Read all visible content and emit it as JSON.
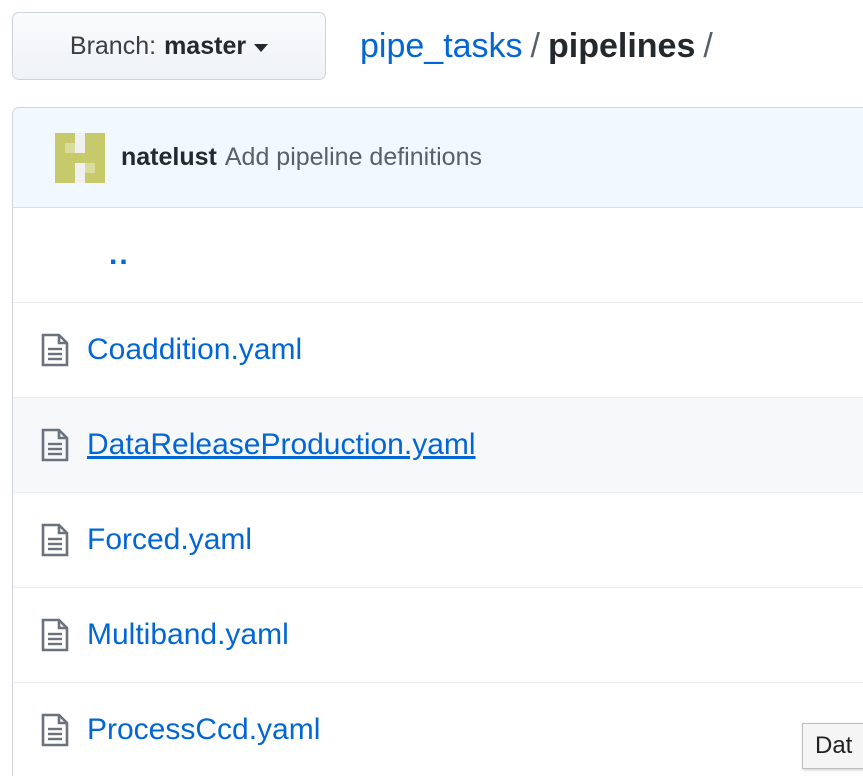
{
  "branch_selector": {
    "prefix": "Branch:",
    "branch": "master"
  },
  "breadcrumb": {
    "repo": "pipe_tasks",
    "separator": "/",
    "current": "pipelines",
    "trailing_separator": "/"
  },
  "commit": {
    "author": "natelust",
    "message": "Add pipeline definitions"
  },
  "files": {
    "parent_link": "..",
    "items": [
      {
        "name": "Coaddition.yaml",
        "icon": "file-icon"
      },
      {
        "name": "DataReleaseProduction.yaml",
        "icon": "file-icon",
        "hovered": true
      },
      {
        "name": "Forced.yaml",
        "icon": "file-icon"
      },
      {
        "name": "Multiband.yaml",
        "icon": "file-icon"
      },
      {
        "name": "ProcessCcd.yaml",
        "icon": "file-icon"
      }
    ]
  },
  "tooltip": {
    "text": "Dat"
  },
  "colors": {
    "link": "#0366d6",
    "commit_bar_bg": "#f1f8ff",
    "hover_row_bg": "#f6f8fa",
    "avatar": "#c6ca6b"
  }
}
